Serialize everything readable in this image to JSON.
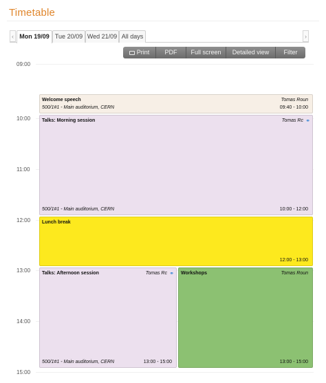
{
  "page_title": "Timetable",
  "day_tabs": [
    "Mon 19/09",
    "Tue 20/09",
    "Wed 21/09",
    "All days"
  ],
  "nav": {
    "prev": "‹",
    "next": "›"
  },
  "toolbar": {
    "print": "Print",
    "pdf": "PDF",
    "full_screen": "Full screen",
    "detailed_view": "Detailed view",
    "filter": "Filter"
  },
  "hours": [
    "09:00",
    "10:00",
    "11:00",
    "12:00",
    "13:00",
    "14:00",
    "15:00"
  ],
  "colors": {
    "title": "#e0862c",
    "welcome": "#f7efe6",
    "talks": "#ece0ee",
    "lunch": "#fde91e",
    "workshops": "#8cc172"
  },
  "entries": {
    "welcome": {
      "title": "Welcome speech",
      "speaker": "Tomas Roun",
      "room": "500/1#1 - Main auditorium, CERN",
      "time": "09:40 - 10:00"
    },
    "morning": {
      "title": "Talks: Morning session",
      "speaker": "Tomas Rc",
      "room": "500/1#1 - Main auditorium, CERN",
      "time": "10:00 - 12:00",
      "icon": "paperclip-icon"
    },
    "lunch": {
      "title": "Lunch break",
      "time": "12:00 - 13:00"
    },
    "afternoon": {
      "title": "Talks: Afternoon session",
      "speaker": "Tomas Rc",
      "room": "500/1#1 - Main auditorium, CERN",
      "time": "13:00 - 15:00",
      "icon": "paperclip-icon"
    },
    "workshops": {
      "title": "Workshops",
      "speaker": "Tomas Roun",
      "time": "13:00 - 15:00"
    }
  }
}
